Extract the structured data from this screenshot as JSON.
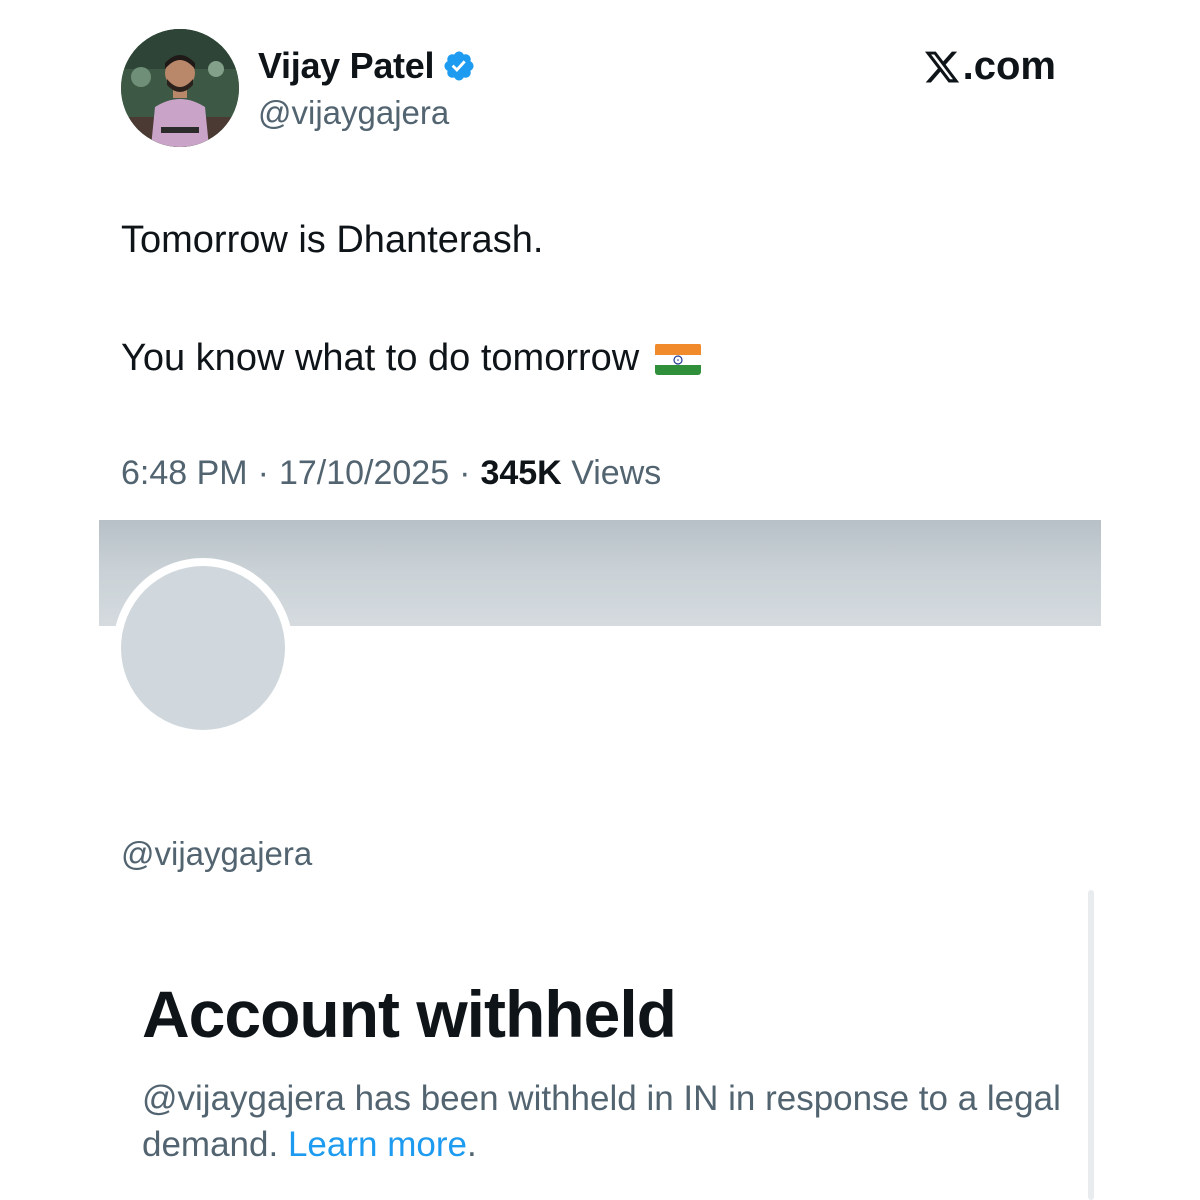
{
  "tweet": {
    "author": {
      "display_name": "Vijay Patel",
      "handle": "@vijaygajera",
      "verified": true,
      "verified_badge_icon": "verified-badge-icon",
      "avatar_icon": "profile-photo"
    },
    "brand": {
      "icon": "x-logo-icon",
      "suffix": ".com"
    },
    "text_line_1": "Tomorrow is Dhanterash.",
    "text_line_2": "You know what to do tomorrow",
    "emoji": "india-flag",
    "time": "6:48 PM",
    "separator": "·",
    "date": "17/10/2025",
    "views_count": "345K",
    "views_label": "Views"
  },
  "profile": {
    "handle": "@vijaygajera",
    "withheld_title": "Account withheld",
    "withheld_message": "@vijaygajera has been withheld in IN in response to a legal demand.",
    "learn_more": "Learn more",
    "trailing_period": "."
  },
  "colors": {
    "primary_text": "#0f1419",
    "secondary_text": "#536471",
    "link": "#1d9bf0",
    "verified": "#1d9bf0",
    "banner": "#c9d1d6",
    "avatar_placeholder": "#d0d8dd"
  }
}
